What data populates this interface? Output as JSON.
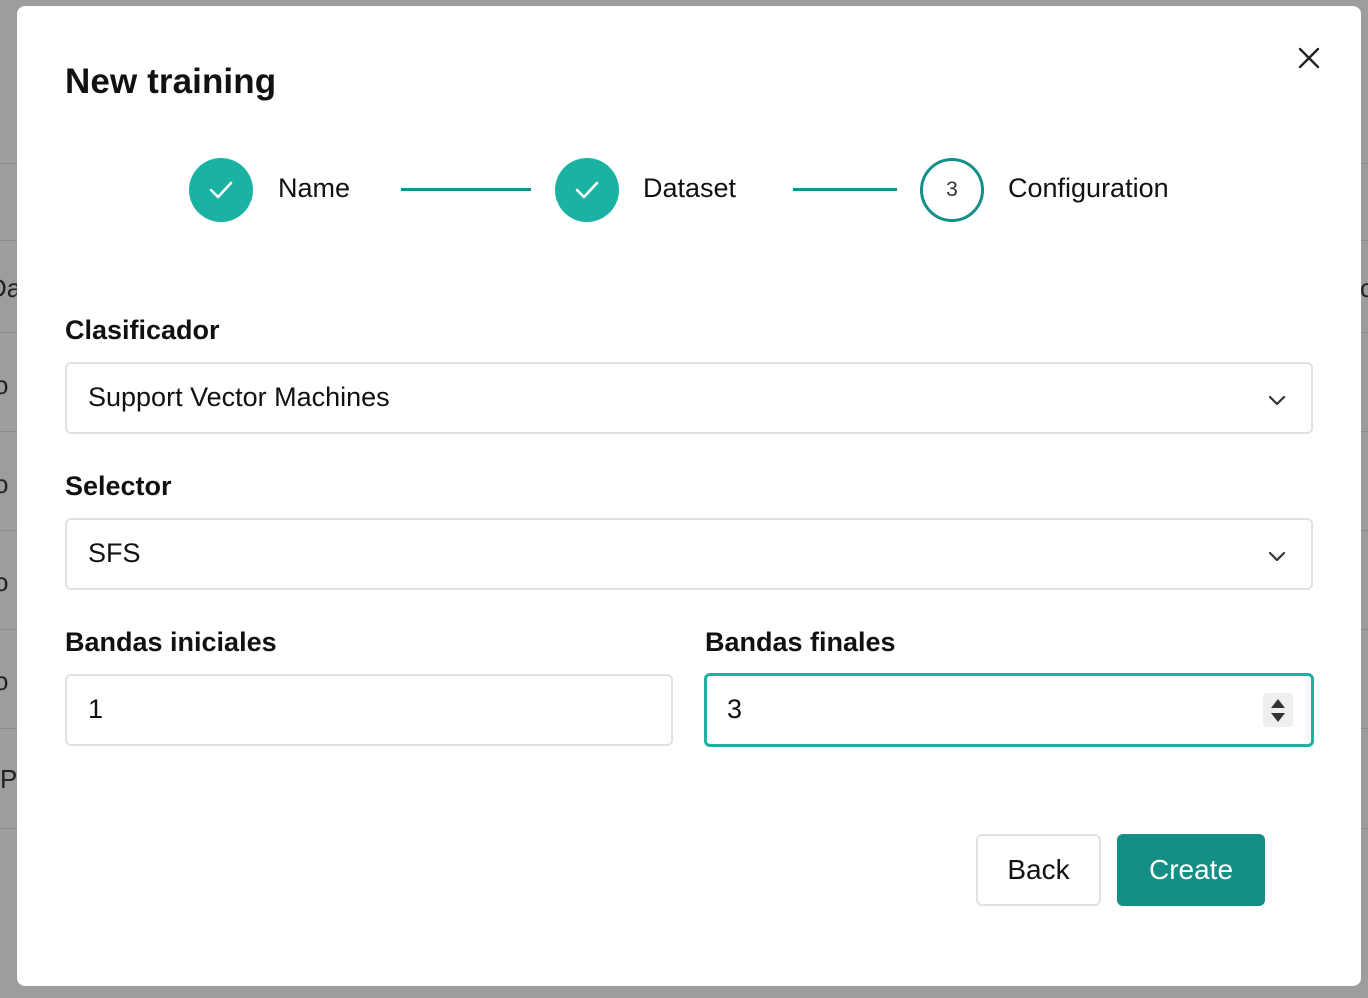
{
  "background": {
    "row_fragments": [
      "Da",
      "o",
      "o",
      "o",
      "o",
      "P",
      "c"
    ]
  },
  "modal": {
    "title": "New training",
    "close_icon": "close-icon"
  },
  "stepper": {
    "steps": [
      {
        "label": "Name",
        "state": "done",
        "icon": "check-icon"
      },
      {
        "label": "Dataset",
        "state": "done",
        "icon": "check-icon"
      },
      {
        "label": "Configuration",
        "state": "current",
        "number": "3"
      }
    ],
    "accent_color": "#1ab3a3",
    "line_color": "#15908a"
  },
  "form": {
    "classifier": {
      "label": "Clasificador",
      "value": "Support Vector Machines"
    },
    "selector": {
      "label": "Selector",
      "value": "SFS"
    },
    "initial_bands": {
      "label": "Bandas iniciales",
      "value": "1"
    },
    "final_bands": {
      "label": "Bandas finales",
      "value": "3"
    }
  },
  "actions": {
    "back_label": "Back",
    "create_label": "Create",
    "create_color": "#138f86"
  }
}
